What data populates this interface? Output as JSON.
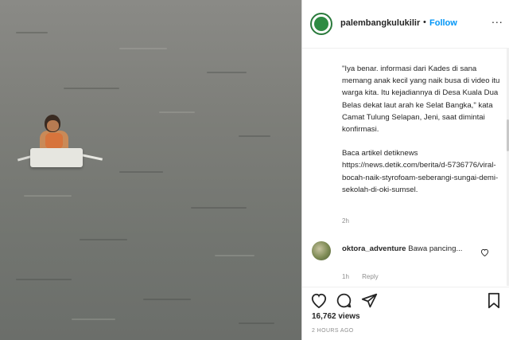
{
  "post": {
    "username": "palembangkulukilir",
    "separator": "•",
    "follow_label": "Follow",
    "more_label": "..."
  },
  "caption": {
    "paragraph1": "\"Iya benar. informasi dari Kades di sana memang anak kecil yang naik busa di video itu warga kita. Itu kejadiannya di Desa Kuala Dua Belas dekat laut arah ke Selat Bangka,\" kata Camat Tulung Selapan, Jeni, saat dimintai konfirmasi.",
    "paragraph2": "Baca artikel detiknews https://news.detik.com/berita/d-5736776/viral-bocah-naik-styrofoam-seberangi-sungai-demi-sekolah-di-oki-sumsel.",
    "time": "2h"
  },
  "comment": {
    "username": "oktora_adventure",
    "text": "Bawa pancing...",
    "time": "1h",
    "reply_label": "Reply"
  },
  "stats": {
    "views": "16,762 views",
    "posted": "2 HOURS AGO"
  },
  "icons": [
    "heart-icon",
    "comment-icon",
    "share-icon",
    "bookmark-icon",
    "more-icon"
  ]
}
